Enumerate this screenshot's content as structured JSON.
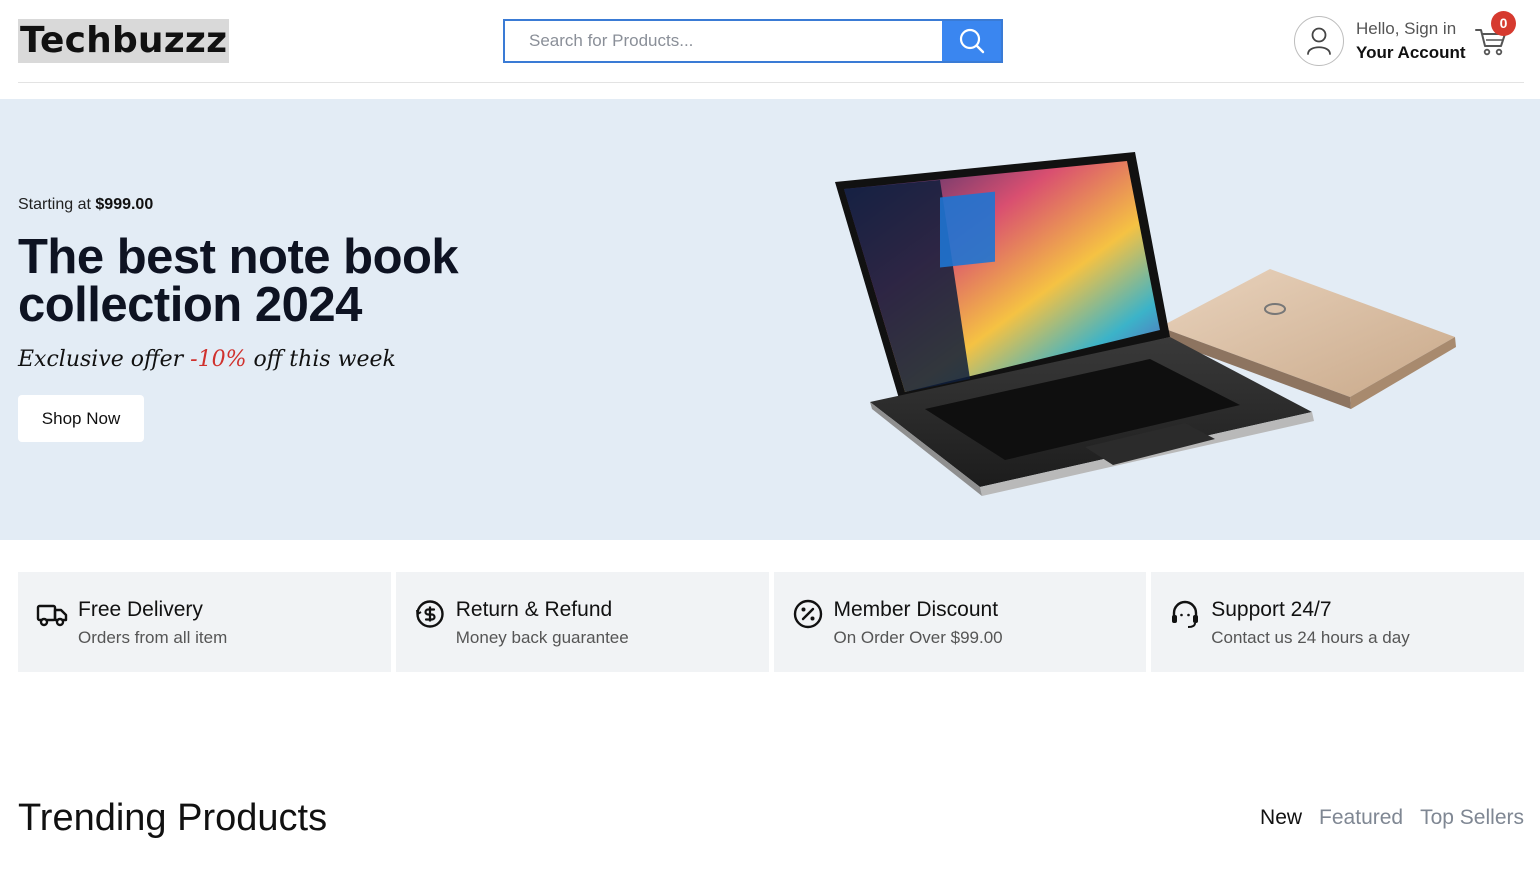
{
  "header": {
    "logo": "Techbuzzz",
    "search_placeholder": "Search for Products...",
    "account_hello": "Hello, Sign in",
    "account_main": "Your Account",
    "cart_count": "0"
  },
  "hero": {
    "starting_prefix": "Starting at",
    "starting_price": "$999.00",
    "title": "The best note book collection 2024",
    "offer_prefix": "Exclusive offer",
    "offer_percent": "-10%",
    "offer_suffix": "off this week",
    "cta": "Shop Now"
  },
  "features": [
    {
      "icon": "truck-icon",
      "title": "Free Delivery",
      "subtitle": "Orders from all item"
    },
    {
      "icon": "refund-icon",
      "title": "Return & Refund",
      "subtitle": "Money back guarantee"
    },
    {
      "icon": "discount-icon",
      "title": "Member Discount",
      "subtitle": "On Order Over $99.00"
    },
    {
      "icon": "headset-icon",
      "title": "Support 24/7",
      "subtitle": "Contact us 24 hours a day"
    }
  ],
  "trending": {
    "title": "Trending Products",
    "tabs": [
      "New",
      "Featured",
      "Top Sellers"
    ],
    "active_tab": "New"
  },
  "colors": {
    "accent": "#3a86f0",
    "hero_bg": "#e3ecf5",
    "badge": "#d63a2f",
    "offer_red": "#d0312d"
  }
}
